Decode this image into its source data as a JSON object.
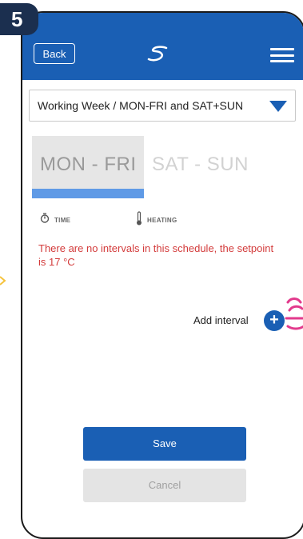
{
  "step": {
    "number": "5"
  },
  "header": {
    "back_label": "Back",
    "logo_icon": "brand-logo-icon",
    "menu_icon": "hamburger-menu-icon",
    "background": "#1a5fb4"
  },
  "schedule_select": {
    "value": "Working Week / MON-FRI and SAT+SUN",
    "caret_icon": "triangle-down-icon"
  },
  "tabs": [
    {
      "label": "MON - FRI",
      "active": true
    },
    {
      "label": "SAT - SUN",
      "active": false
    }
  ],
  "columns": {
    "time": {
      "label": "TIME",
      "icon": "stopwatch-icon"
    },
    "heating": {
      "label": "HEATING",
      "icon": "thermometer-icon"
    }
  },
  "message": "There are no intervals in this schedule, the setpoint is 17 °C",
  "add_interval": {
    "label": "Add interval",
    "icon": "plus-icon"
  },
  "buttons": {
    "save": "Save",
    "cancel": "Cancel"
  },
  "colors": {
    "primary": "#1a5fb4",
    "tab_underline": "#5f9ae6",
    "error_text": "#d33b3b",
    "hand_accent": "#e23a8c",
    "arrow_accent": "#f5c23a"
  }
}
